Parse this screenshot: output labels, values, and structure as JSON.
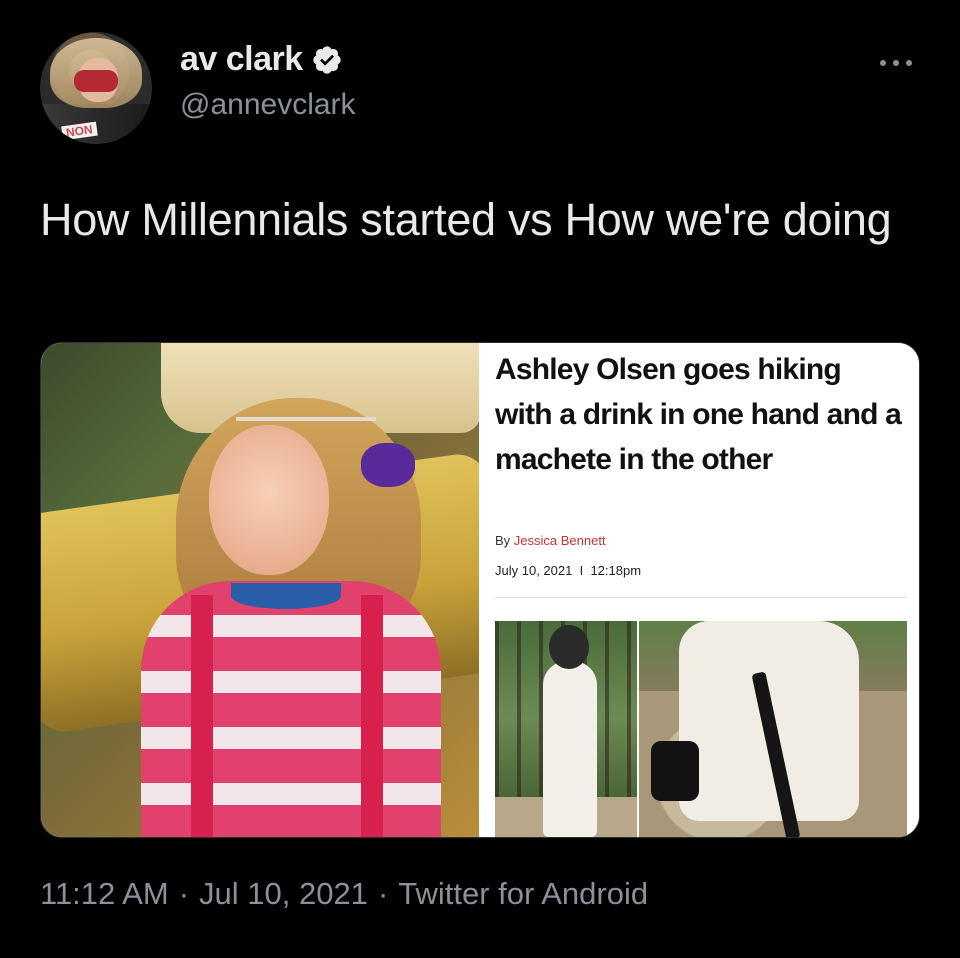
{
  "tweet": {
    "display_name": "av clark",
    "handle": "@annevclark",
    "text": "How Millennials started vs How we're doing",
    "time": "11:12 AM",
    "separator": "·",
    "date": "Jul 10, 2021",
    "source": "Twitter for Android",
    "verified": true,
    "avatar_shirt_text": "NON"
  },
  "icons": {
    "verified": "verified-badge-icon",
    "more": "more-options-icon"
  },
  "media": {
    "left_image": "girl-with-tiara-photo",
    "article": {
      "headline": "Ashley Olsen goes hiking with a drink in one hand and a machete in the other",
      "byline_prefix": "By",
      "author": "Jessica Bennett",
      "date": "July 10, 2021",
      "date_separator": "I",
      "time": "12:18pm"
    }
  },
  "colors": {
    "background": "#000000",
    "text_primary": "#e7e9ea",
    "text_secondary": "#8b9199",
    "author_link": "#c0392b"
  }
}
